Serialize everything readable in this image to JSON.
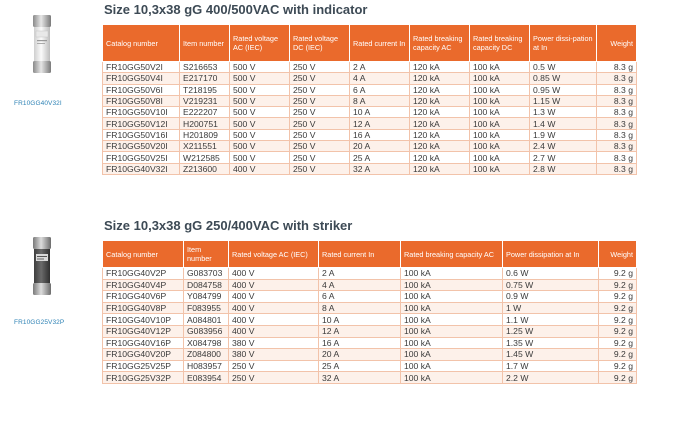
{
  "sections": [
    {
      "title": "Size 10,3x38 gG 400/500VAC with indicator",
      "image_label": "FR10GG40V32I",
      "headers": [
        "Catalog number",
        "Item number",
        "Rated voltage AC (IEC)",
        "Rated voltage DC (IEC)",
        "Rated current In",
        "Rated breaking capacity AC",
        "Rated breaking capacity DC",
        "Power dissi-pation at In",
        "Weight"
      ],
      "rows": [
        [
          "FR10GG50V2I",
          "S216653",
          "500 V",
          "250 V",
          "2 A",
          "120 kA",
          "100 kA",
          "0.5 W",
          "8.3 g"
        ],
        [
          "FR10GG50V4I",
          "E217170",
          "500 V",
          "250 V",
          "4 A",
          "120 kA",
          "100 kA",
          "0.85 W",
          "8.3 g"
        ],
        [
          "FR10GG50V6I",
          "T218195",
          "500 V",
          "250 V",
          "6 A",
          "120 kA",
          "100 kA",
          "0.95 W",
          "8.3 g"
        ],
        [
          "FR10GG50V8I",
          "V219231",
          "500 V",
          "250 V",
          "8 A",
          "120 kA",
          "100 kA",
          "1.15 W",
          "8.3 g"
        ],
        [
          "FR10GG50V10I",
          "E222207",
          "500 V",
          "250 V",
          "10 A",
          "120 kA",
          "100 kA",
          "1.3 W",
          "8.3 g"
        ],
        [
          "FR10GG50V12I",
          "H200751",
          "500 V",
          "250 V",
          "12 A",
          "120 kA",
          "100 kA",
          "1.4 W",
          "8.3 g"
        ],
        [
          "FR10GG50V16I",
          "H201809",
          "500 V",
          "250 V",
          "16 A",
          "120 kA",
          "100 kA",
          "1.9 W",
          "8.3 g"
        ],
        [
          "FR10GG50V20I",
          "X211551",
          "500 V",
          "250 V",
          "20 A",
          "120 kA",
          "100 kA",
          "2.4 W",
          "8.3 g"
        ],
        [
          "FR10GG50V25I",
          "W212585",
          "500 V",
          "250 V",
          "25 A",
          "120 kA",
          "100 kA",
          "2.7 W",
          "8.3 g"
        ],
        [
          "FR10GG40V32I",
          "Z213600",
          "400 V",
          "250 V",
          "32 A",
          "120 kA",
          "100 kA",
          "2.8 W",
          "8.3 g"
        ]
      ]
    },
    {
      "title": "Size 10,3x38 gG 250/400VAC with striker",
      "image_label": "FR10GG25V32P",
      "headers": [
        "Catalog number",
        "Item number",
        "Rated voltage AC (IEC)",
        "Rated current In",
        "Rated breaking capacity AC",
        "Power dissipation at In",
        "Weight"
      ],
      "rows": [
        [
          "FR10GG40V2P",
          "G083703",
          "400 V",
          "2 A",
          "100 kA",
          "0.6 W",
          "9.2 g"
        ],
        [
          "FR10GG40V4P",
          "D084758",
          "400 V",
          "4 A",
          "100 kA",
          "0.75 W",
          "9.2 g"
        ],
        [
          "FR10GG40V6P",
          "Y084799",
          "400 V",
          "6 A",
          "100 kA",
          "0.9 W",
          "9.2 g"
        ],
        [
          "FR10GG40V8P",
          "F083955",
          "400 V",
          "8 A",
          "100 kA",
          "1 W",
          "9.2 g"
        ],
        [
          "FR10GG40V10P",
          "A084801",
          "400 V",
          "10 A",
          "100 kA",
          "1.1 W",
          "9.2 g"
        ],
        [
          "FR10GG40V12P",
          "G083956",
          "400 V",
          "12 A",
          "100 kA",
          "1.25 W",
          "9.2 g"
        ],
        [
          "FR10GG40V16P",
          "X084798",
          "380 V",
          "16 A",
          "100 kA",
          "1.35 W",
          "9.2 g"
        ],
        [
          "FR10GG40V20P",
          "Z084800",
          "380 V",
          "20 A",
          "100 kA",
          "1.45 W",
          "9.2 g"
        ],
        [
          "FR10GG25V25P",
          "H083957",
          "250 V",
          "25 A",
          "100 kA",
          "1.7 W",
          "9.2 g"
        ],
        [
          "FR10GG25V32P",
          "E083954",
          "250 V",
          "32 A",
          "100 kA",
          "2.2 W",
          "9.2 g"
        ]
      ]
    }
  ],
  "colors": {
    "header_bg": "#ea6a2c",
    "title": "#3d4a55",
    "image_label": "#2d82b5",
    "row_alt": "#fdf1ea"
  }
}
